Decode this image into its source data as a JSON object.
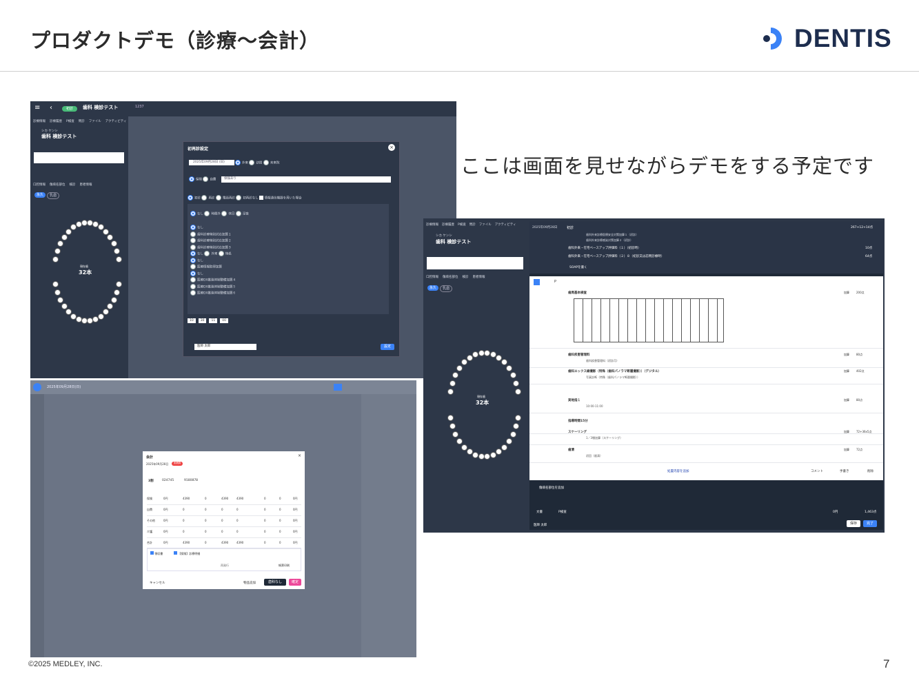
{
  "slide": {
    "title": "プロダクトデモ（診療〜会計）",
    "logo_text": "DENTIS",
    "caption": "ここは画面を見せながらデモをする予定です",
    "copyright": "©2025 MEDLEY, INC.",
    "page_number": "7",
    "colors": {
      "logo_dark": "#1d2d4e",
      "logo_accent": "#3b82f6",
      "app_dark": "#2d3748",
      "app_blue": "#3b82f6"
    }
  },
  "shot1": {
    "patient_name": "歯科 検診テスト",
    "patient_kana": "シカ ケンシ",
    "patient_id": "1237",
    "status_badge": "初診",
    "tabs": [
      "診療情報",
      "診療履歴",
      "P検査",
      "問診",
      "ファイル",
      "アクティビティ"
    ],
    "sub_tabs": [
      "口腔情報",
      "傷病名部位",
      "検診",
      "患者情報"
    ],
    "toggle": [
      "永久",
      "乳歯"
    ],
    "tooth_count": "32本",
    "tooth_label": "現存歯",
    "dialog": {
      "title": "初再診設定",
      "date": "2025年09月28日 (日)",
      "visit_options": [
        "外来",
        "訪問",
        "未来院"
      ],
      "insurance_options": [
        "保険",
        "自費"
      ],
      "insurance_select": "保険あり",
      "category_options": [
        "初診",
        "再診",
        "電話再診",
        "初再診なし"
      ],
      "checkbox_label": "情報通信機器を用いた場合",
      "addon_options": [
        "なし",
        "時間外",
        "休日",
        "深夜"
      ],
      "list1": [
        "なし",
        "歯科診療特別対応加算１",
        "歯科診療特別対応加算２",
        "歯科診療特別対応加算３"
      ],
      "list2": [
        "なし",
        "外来",
        "特処"
      ],
      "list3": [
        "なし",
        "医療情報取得加算"
      ],
      "list4": [
        "なし",
        "医療DX推進体制整備加算４",
        "医療DX推進体制整備加算５",
        "医療DX推進体制整備加算６"
      ],
      "time": [
        "10",
        "30",
        "11",
        "00"
      ],
      "doctor": "医師 太郎",
      "confirm": "設定"
    }
  },
  "shot2": {
    "date": "2025年09月28日(日)",
    "dialog_title": "会計",
    "dialog_date": "2025年09月28日",
    "badge": "未精算",
    "patient_label": "歯科 検診テスト",
    "bank": "3割",
    "numbers": [
      "024745",
      "9180878"
    ],
    "rows": [
      {
        "label": "保険",
        "v1": "0円",
        "v2": "4390",
        "v3": "0",
        "v4": "4390",
        "v5": "4390",
        "v6": "0",
        "v7": "0",
        "v8": "0円"
      },
      {
        "label": "自費",
        "v1": "0円",
        "v2": "0",
        "v3": "0",
        "v4": "0",
        "v5": "0",
        "v6": "0",
        "v7": "0",
        "v8": "0円"
      },
      {
        "label": "その他",
        "v1": "0円",
        "v2": "0",
        "v3": "0",
        "v4": "0",
        "v5": "0",
        "v6": "0",
        "v7": "0",
        "v8": "0円"
      },
      {
        "label": "介護",
        "v1": "0円",
        "v2": "0",
        "v3": "0",
        "v4": "0",
        "v5": "0",
        "v6": "0",
        "v7": "0",
        "v8": "0円"
      },
      {
        "label": "合計",
        "v1": "0円",
        "v2": "4390",
        "v3": "0",
        "v4": "4390",
        "v5": "4390",
        "v6": "0",
        "v7": "0",
        "v8": "0円"
      }
    ],
    "check1": "領収書",
    "check2": "【保険】診療明細",
    "reprint": "再発行",
    "print_btn": "帳票印刷",
    "cancel": "キャンセル",
    "back": "物品追加",
    "no_pay": "歯科なし",
    "confirm": "確定"
  },
  "shot3": {
    "patient_name": "歯科 検診テスト",
    "patient_kana": "シカ ケンシ",
    "patient_id": "1237",
    "tabs": [
      "診療情報",
      "診療履歴",
      "P検査",
      "問診",
      "ファイル",
      "アクティビティ"
    ],
    "sub_tabs": [
      "口腔情報",
      "傷病名部位",
      "検診",
      "患者情報"
    ],
    "toggle": [
      "永久",
      "乳歯"
    ],
    "tooth_count": "32本",
    "tooth_label": "現存歯",
    "record_date": "2025年09月28日",
    "header_total": "267+12+14点",
    "first_visit": "初診",
    "items": [
      {
        "title": "歯科外来診療医療安全対策加算１（初診）",
        "points": ""
      },
      {
        "title": "歯科外来診療感染対策加算２（初診）",
        "points": ""
      },
      {
        "title": "歯科外来・在宅ベースアップ評価料（１）（初診時）",
        "points": "10点"
      },
      {
        "title": "歯科外来・在宅ベースアップ評価料（２）８（初診又は訪問診療時）",
        "points": "64点"
      }
    ],
    "soap": "SOAPを書く",
    "section_p": "P",
    "entries": [
      {
        "title": "歯周基本検査",
        "add": "加算",
        "points": "200点"
      },
      {
        "title": "歯科疾患管理料",
        "sub": "歯科疾患管理料（初診月）",
        "add": "加算",
        "points": "80点"
      },
      {
        "title": "歯科エックス線撮影（特殊（歯科パノラマ断層撮影））（デジタル）",
        "sub": "写真診断（特殊（歯科パノラマ断層撮影））",
        "add": "加算",
        "points": "402点"
      },
      {
        "title": "実地指１",
        "sub": "10:00-11:00",
        "add": "加算",
        "points": "80点"
      },
      {
        "title": "指導時間15分",
        "add": "",
        "points": ""
      },
      {
        "title": "スケーリング",
        "sub": "1／3顎加算（スケーリング）",
        "add": "加算",
        "points": "72+36x5点"
      },
      {
        "title": "歯清",
        "sub": "初回（歯清）",
        "add": "加算",
        "points": "72点"
      }
    ],
    "add_entry": "処置内容を追加",
    "comment": "コメント",
    "handwrite": "手書き",
    "delete": "削除",
    "add_disease": "傷病名部位を追加",
    "bottom_left1": "文書",
    "bottom_left2": "P検査",
    "total_label": "0円",
    "total_points": "1,463点",
    "doctor": "医師 太郎",
    "save": "保存",
    "done": "完了"
  }
}
